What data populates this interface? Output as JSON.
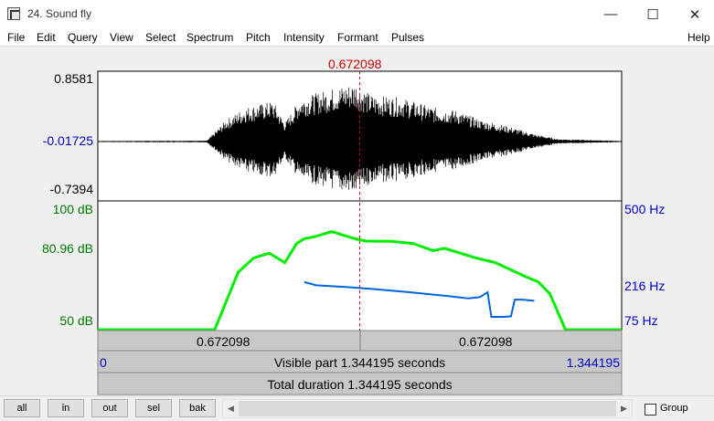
{
  "window": {
    "title": "24. Sound fly"
  },
  "menu": {
    "items": [
      "File",
      "Edit",
      "Query",
      "View",
      "Select",
      "Spectrum",
      "Pitch",
      "Intensity",
      "Formant",
      "Pulses"
    ],
    "help": "Help"
  },
  "cursor": {
    "time_label": "0.672098",
    "time": 0.672098
  },
  "waveform": {
    "max_label": "0.8581",
    "mid_label": "-0.01725",
    "min_label": "-0.7394"
  },
  "intensity_axis": {
    "top_label": "100 dB",
    "mid_label": "80.96 dB",
    "bottom_label": "50 dB",
    "top": 100,
    "mid": 80.96,
    "bottom": 50
  },
  "pitch_axis": {
    "top_label": "500 Hz",
    "mid_label": "216 Hz",
    "bottom_label": "75 Hz",
    "top": 500,
    "mid": 216,
    "bottom": 75
  },
  "colors": {
    "intensity": "#00ee00",
    "pitch": "#0066dd",
    "cursor": "#cc0000",
    "left_axis_green": "#007a00",
    "axis_blue": "#0000cc"
  },
  "timebar": {
    "left_time": "0.672098",
    "right_time": "0.672098",
    "visible_left": "0",
    "visible_text": "Visible part 1.344195 seconds",
    "visible_right": "1.344195",
    "total_text": "Total duration 1.344195 seconds"
  },
  "bottom": {
    "buttons": [
      "all",
      "in",
      "out",
      "sel",
      "bak"
    ],
    "group_label": "Group"
  },
  "chart_data": {
    "type": "line",
    "x_range": [
      0,
      1.344195
    ],
    "series": [
      {
        "name": "",
        "unit": "dB",
        "x": [
          0.0,
          0.3,
          0.33,
          0.36,
          0.4,
          0.44,
          0.48,
          0.51,
          0.53,
          0.56,
          0.6,
          0.64,
          0.66,
          0.69,
          0.75,
          0.81,
          0.86,
          0.89,
          0.93,
          0.97,
          1.02,
          1.06,
          1.1,
          1.13,
          1.16,
          1.2,
          1.3,
          1.344
        ],
        "values": [
          50,
          50,
          62,
          74,
          80,
          82,
          78,
          86,
          88,
          89,
          91,
          89,
          88,
          87,
          87,
          86,
          83,
          84,
          82,
          80,
          78,
          75,
          72,
          70,
          65,
          50,
          50,
          50
        ]
      },
      {
        "name": "",
        "unit": "Hz",
        "x": [
          0.53,
          0.56,
          0.63,
          0.7,
          0.8,
          0.9,
          0.95,
          0.98,
          1.0,
          1.01,
          1.04,
          1.06,
          1.07,
          1.09,
          1.12
        ],
        "values": [
          230,
          218,
          212,
          204,
          190,
          174,
          165,
          170,
          190,
          90,
          90,
          92,
          160,
          160,
          155
        ]
      }
    ]
  }
}
